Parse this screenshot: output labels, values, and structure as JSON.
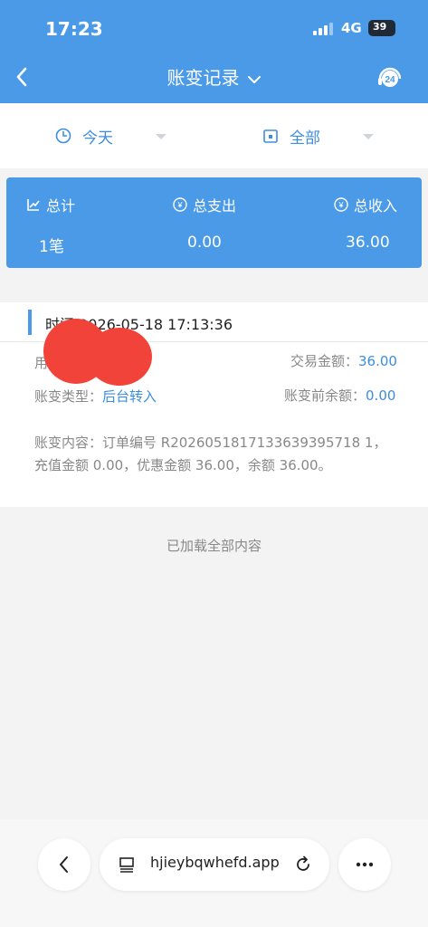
{
  "status_bar": {
    "time": "17:23",
    "network": "4G",
    "battery": "39"
  },
  "nav": {
    "title": "账变记录"
  },
  "filters": {
    "date": "今天",
    "type": "全部"
  },
  "summary": {
    "total_label": "总计",
    "total_value": "1笔",
    "expense_label": "总支出",
    "expense_value": "0.00",
    "income_label": "总收入",
    "income_value": "36.00"
  },
  "record": {
    "time_text": "时间 2026-05-18 17:13:36",
    "user_label": "用",
    "amount_label": "交易金额：",
    "amount_value": "36.00",
    "type_label": "账变类型：",
    "type_value": "后台转入",
    "balance_before_label": "账变前余额：",
    "balance_before_value": "0.00",
    "content": "账变内容：订单编号 R2026051817133639395718 1，充值金额 0.00，优惠金额 36.00，余额 36.00。"
  },
  "list_end_text": "已加载全部内容",
  "browser": {
    "url": "hjieybqwhefd.app"
  },
  "colors": {
    "primary": "#4a9ae8",
    "link": "#3c8de0",
    "redaction": "#f2433a"
  }
}
